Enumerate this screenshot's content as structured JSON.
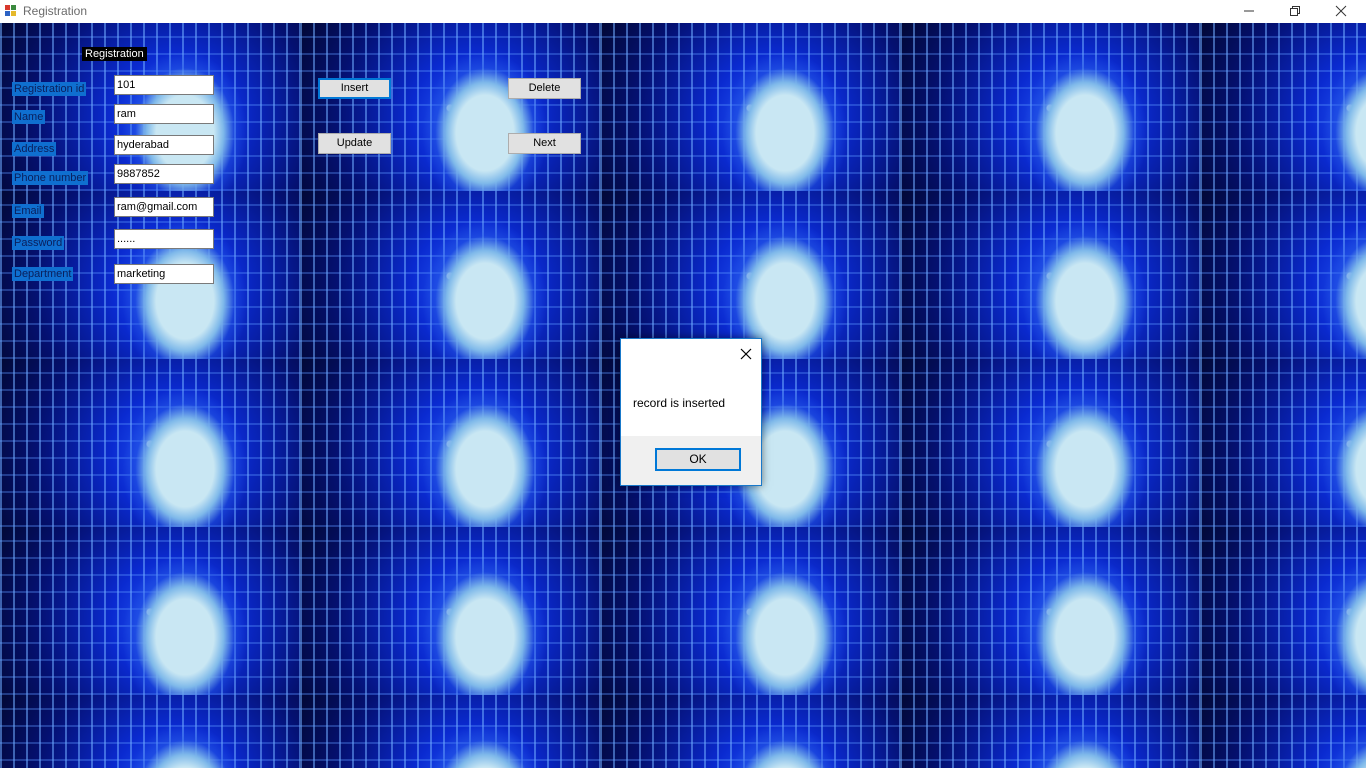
{
  "window": {
    "title": "Registration"
  },
  "form": {
    "group_label": "Registration",
    "fields": [
      {
        "label": "Registration id",
        "value": "101"
      },
      {
        "label": "Name",
        "value": "ram"
      },
      {
        "label": "Address",
        "value": "hyderabad"
      },
      {
        "label": "Phone number",
        "value": "9887852"
      },
      {
        "label": "Email",
        "value": "ram@gmail.com"
      },
      {
        "label": "Password",
        "value": "......"
      },
      {
        "label": "Department",
        "value": "marketing"
      }
    ],
    "buttons": {
      "insert": "Insert",
      "delete": "Delete",
      "update": "Update",
      "next": "Next"
    }
  },
  "dialog": {
    "message": "record is inserted",
    "ok_label": "OK"
  },
  "colors": {
    "label_background": "#0f6fd0",
    "dialog_border": "#1979ca",
    "focus_accent": "#0078d7"
  },
  "icons": [
    "app-icon",
    "minimize-icon",
    "restore-icon",
    "close-icon"
  ]
}
